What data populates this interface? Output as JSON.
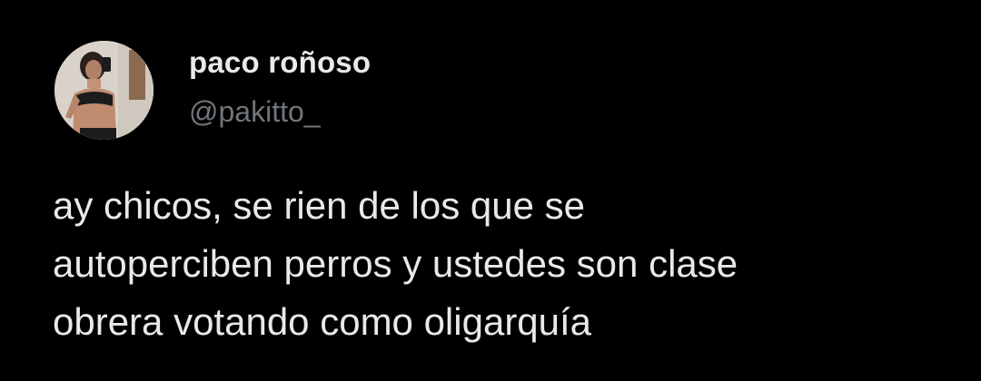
{
  "author": {
    "display_name": "paco roñoso",
    "handle": "@pakitto_",
    "avatar_icon": "profile-photo-icon"
  },
  "tweet": {
    "lines": [
      "ay chicos, se rien de los que se",
      "autoperciben perros y ustedes son clase",
      "obrera votando como oligarquía"
    ]
  },
  "colors": {
    "background": "#000000",
    "primary_text": "#e7e9ea",
    "secondary_text": "#71767b"
  }
}
